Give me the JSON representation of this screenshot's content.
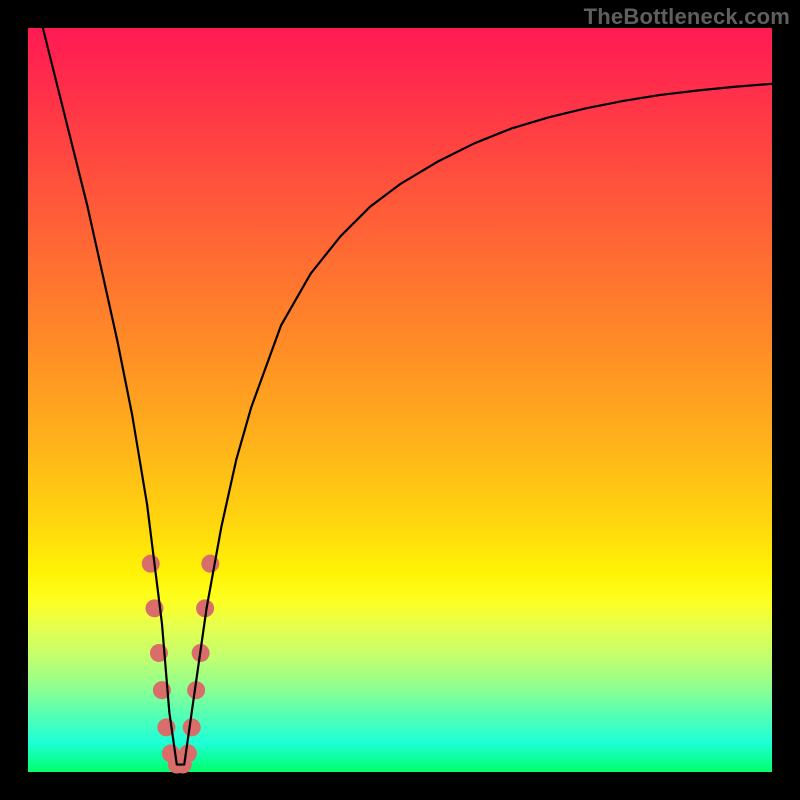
{
  "watermark": "TheBottleneck.com",
  "colors": {
    "marker": "#d86d6a",
    "curve": "#000000",
    "frame": "#000000"
  },
  "chart_data": {
    "type": "line",
    "title": "",
    "xlabel": "",
    "ylabel": "",
    "xlim": [
      0,
      100
    ],
    "ylim": [
      0,
      100
    ],
    "curve": {
      "comment": "x = percent across plot width, y = percent bottleneck (0 at bottom/green, 100 at top/red)",
      "x": [
        2,
        4,
        6,
        8,
        10,
        12,
        14,
        16,
        18,
        19,
        20,
        21,
        22,
        24,
        26,
        28,
        30,
        34,
        38,
        42,
        46,
        50,
        55,
        60,
        65,
        70,
        75,
        80,
        85,
        90,
        95,
        100
      ],
      "y": [
        100,
        92,
        84,
        76,
        67,
        58,
        48,
        36,
        20,
        8,
        1,
        1,
        8,
        22,
        33,
        42,
        49,
        60,
        67,
        72,
        76,
        79,
        82,
        84.5,
        86.5,
        88,
        89.2,
        90.2,
        91,
        91.6,
        92.1,
        92.5
      ]
    },
    "markers": {
      "comment": "approximate salmon dot positions along the V near the trough",
      "points": [
        {
          "x": 16.5,
          "y": 28
        },
        {
          "x": 17.0,
          "y": 22
        },
        {
          "x": 17.6,
          "y": 16
        },
        {
          "x": 18.0,
          "y": 11
        },
        {
          "x": 18.6,
          "y": 6
        },
        {
          "x": 19.2,
          "y": 2.5
        },
        {
          "x": 20.0,
          "y": 1.0
        },
        {
          "x": 20.8,
          "y": 1.0
        },
        {
          "x": 21.5,
          "y": 2.5
        },
        {
          "x": 22.0,
          "y": 6
        },
        {
          "x": 22.6,
          "y": 11
        },
        {
          "x": 23.2,
          "y": 16
        },
        {
          "x": 23.8,
          "y": 22
        },
        {
          "x": 24.5,
          "y": 28
        }
      ]
    }
  }
}
